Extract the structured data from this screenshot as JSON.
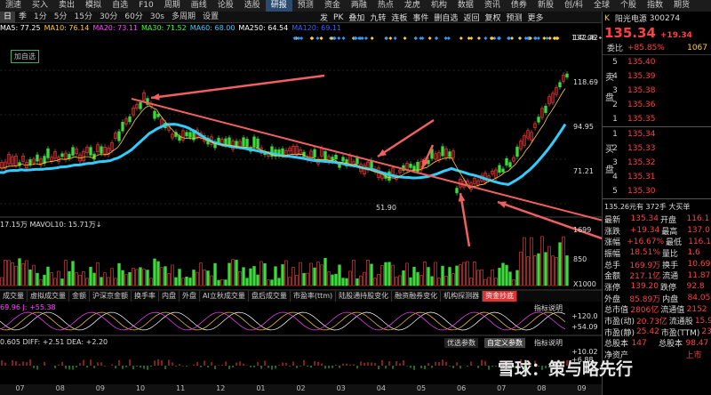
{
  "menu": [
    "测速",
    "买入",
    "卖出",
    "模拟",
    "自选",
    "F10",
    "周期",
    "画线",
    "论股",
    "选股",
    "研报",
    "预测",
    "资金",
    "两融",
    "热点",
    "龙虎",
    "机构",
    "数据",
    "资讯",
    "债券",
    "新股",
    "创/科",
    "全球",
    "个股",
    "指数",
    "期货"
  ],
  "menu_active": "研报",
  "periods": [
    "日",
    "季",
    "1分",
    "5分",
    "15分",
    "30分",
    "60分",
    "30s",
    "多周期",
    "设置"
  ],
  "period_active": "日",
  "toolbar_right": [
    "发",
    "PK",
    "叠加",
    "九转",
    "连板",
    "事件",
    "删自选",
    "返回",
    "复权",
    "预测",
    "更多"
  ],
  "ma_line": [
    {
      "t": "MA5: 77.25",
      "c": "#ffffff"
    },
    {
      "t": "MA10: 76.14",
      "c": "#ffcc33"
    },
    {
      "t": "MA20: 73.11",
      "c": "#ff44ff"
    },
    {
      "t": "MA30: 71.52",
      "c": "#33ff33"
    },
    {
      "t": "MA60: 68.00",
      "c": "#33ccff"
    },
    {
      "t": "MA250: 64.54",
      "c": "#ffffff"
    },
    {
      "t": "MA120: 69.11",
      "c": "#3366ff"
    }
  ],
  "add_fav": "加自选",
  "price_axis": [
    "142.42",
    "118.69",
    "94.95",
    "71.21"
  ],
  "high_label": "137.06 ←",
  "low_label": "51.90",
  "vol_label": "17.15万 MAVOL10: 15.71万↓",
  "vol_axis": [
    "1699",
    "850",
    "X1000"
  ],
  "indicator_tabs": [
    "成交量",
    "虚拟成交量",
    "金额",
    "沪深京金额",
    "换手率",
    "内盘",
    "外盘",
    "AI立秋成交量",
    "盘后成交量",
    "市盈率(ttm)",
    "陆股通持股变化",
    "融资融券变化",
    "机构探测器",
    "资金抄底"
  ],
  "kdj_label": "69.96  J: +55.38",
  "kdj_axis": [
    "+120.0",
    "+54.09"
  ],
  "macd_label": "0.605  DIFF: +2.51  DEA: +2.20",
  "macd_axis": [
    "+10.02",
    "+6.88"
  ],
  "indicator_link": "指标说明",
  "param_buttons": [
    "优选参数",
    "自定义参数"
  ],
  "months": [
    "07",
    "08",
    "09",
    "10",
    "11",
    "12",
    "01",
    "02",
    "03",
    "04",
    "05",
    "06",
    "07",
    "08",
    "09"
  ],
  "stock": {
    "code_badge": "K",
    "name": "阳光电源",
    "code": "300274",
    "price": "135.34",
    "change": "+19.34",
    "ratio_label": "委比",
    "ratio": "+85.85%",
    "ratio_diff": "1067",
    "asks": [
      {
        "n": "5",
        "p": "135.40"
      },
      {
        "n": "4",
        "p": "135.39"
      },
      {
        "n": "3",
        "p": "135.38"
      },
      {
        "n": "2",
        "p": "135.36"
      },
      {
        "n": "1",
        "p": "135.35"
      }
    ],
    "bids": [
      {
        "n": "1",
        "p": "135.34"
      },
      {
        "n": "2",
        "p": "135.33"
      },
      {
        "n": "3",
        "p": "135.32"
      },
      {
        "n": "4",
        "p": "135.31"
      },
      {
        "n": "5",
        "p": "135.30"
      }
    ],
    "big_order": "135.26元有 372手 大买单",
    "info": [
      [
        "最新",
        "135.34",
        "开盘",
        "116.1"
      ],
      [
        "涨跌",
        "+19.34",
        "最高",
        "137.0"
      ],
      [
        "涨幅",
        "+16.67%",
        "最低",
        "116.1"
      ],
      [
        "振幅",
        "18.51%",
        "量比",
        "1.6"
      ],
      [
        "总手",
        "169.9万",
        "换手",
        "10.69"
      ],
      [
        "金额",
        "217.1亿",
        "流通",
        "11.87"
      ],
      [
        "涨停",
        "139.20",
        "跌停",
        "92.8"
      ],
      [
        "外盘",
        "85.89万",
        "内盘",
        "84.05"
      ],
      [
        "总市值",
        "2806亿",
        "流通值",
        "2152"
      ],
      [
        "市盈(动)",
        "20.73亿",
        "流通股",
        "15.90"
      ],
      [
        "市盈(静)",
        "25.42",
        "市盈(TTM)",
        "23.86"
      ],
      [
        "总股本",
        "147",
        "总股本",
        "98.47"
      ],
      [
        "净资产",
        "",
        "",
        "上市"
      ]
    ],
    "side_ask": [
      "卖",
      "盘"
    ],
    "side_bid": [
      "买",
      "盘"
    ]
  },
  "watermark": "雪球：策与略先行"
}
